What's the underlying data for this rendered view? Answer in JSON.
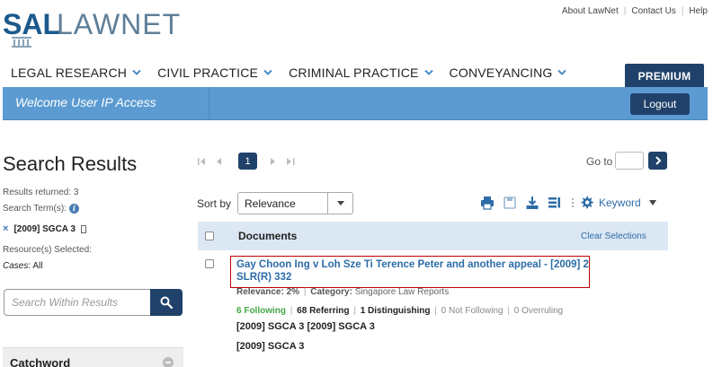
{
  "brand": {
    "logo_sal": "SAL",
    "logo_lawnet": "LAWNET"
  },
  "top_links": [
    "About LawNet",
    "Contact Us",
    "Help"
  ],
  "nav": {
    "items": [
      "LEGAL RESEARCH",
      "CIVIL PRACTICE",
      "CRIMINAL PRACTICE",
      "CONVEYANCING"
    ],
    "premium_label": "PREMIUM"
  },
  "welcome": {
    "text": "Welcome User IP Access",
    "logout_label": "Logout"
  },
  "left_panel": {
    "title": "Search Results",
    "results_returned": "Results returned: 3",
    "search_terms_label": "Search Term(s):",
    "search_term": "[2009] SGCA 3",
    "resources_label": "Resource(s) Selected:",
    "cases_label": "Cases",
    "cases_value": ": All",
    "search_within_placeholder": "Search Within Results",
    "catchword_label": "Catchword"
  },
  "pagination": {
    "current_page": "1",
    "goto_label": "Go to",
    "goto_value": ""
  },
  "sort": {
    "label": "Sort by",
    "selected": "Relevance"
  },
  "toolbar": {
    "icons": [
      "print-icon",
      "save-icon",
      "download-icon",
      "view-options-icon",
      "settings-icon"
    ],
    "keyword_label": "Keyword"
  },
  "documents": {
    "header": "Documents",
    "clear_selections": "Clear Selections",
    "results": [
      {
        "title": "Gay Choon Ing v Loh Sze Ti Terence Peter and another appeal - [2009] 2 SLR(R) 332",
        "relevance_label": "Relevance:",
        "relevance_value": "2%",
        "category_label": "Category:",
        "category_value": "Singapore Law Reports",
        "following": "6 Following",
        "referring": "68 Referring",
        "distinguishing": "1 Distinguishing",
        "not_following": "0 Not Following",
        "overruling": "0 Overruling",
        "citation_line1": "[2009] SGCA 3 [2009] SGCA 3",
        "citation_line2": "[2009] SGCA 3"
      }
    ]
  },
  "colors": {
    "brand_navy": "#20426a",
    "welcome_bar": "#5b9bd1",
    "link_blue": "#2d6ca8",
    "highlight_border": "#c00000",
    "following_green": "#46a846"
  }
}
